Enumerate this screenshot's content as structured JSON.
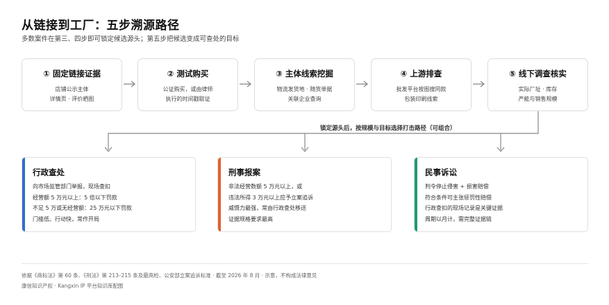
{
  "title": "从链接到工厂：五步溯源路径",
  "subtitle": "多数案件在第三、四步即可锁定候选源头；第五步把候选变成可查处的目标",
  "steps": [
    {
      "title": "① 固定链接证据",
      "lines": [
        "店铺公示主体",
        "详情页 · 评价晒图"
      ]
    },
    {
      "title": "② 测试购买",
      "lines": [
        "公证购买，或由律师",
        "执行的时间戳取证"
      ]
    },
    {
      "title": "③ 主体线索挖掘",
      "lines": [
        "物流发货地 · 随货单据",
        "关联企业查询"
      ]
    },
    {
      "title": "④ 上游排查",
      "lines": [
        "批发平台按图搜同款",
        "包装印刷线索"
      ]
    },
    {
      "title": "⑤ 线下调查核实",
      "lines": [
        "实际厂址 · 库存",
        "产能与销售规模"
      ]
    }
  ],
  "flow_label": "锁定源头后，按规模与目标选择打击路径（可组合）",
  "cards": [
    {
      "title": "行政查处",
      "color": "#2f6fd0",
      "lines": [
        "向市场监管部门举报，现场查扣",
        "经营额 5 万元以上：5 倍以下罚款",
        "不足 5 万或无经营额：25 万元以下罚款",
        "门槛低、行动快，常作开局"
      ]
    },
    {
      "title": "刑事报案",
      "color": "#e0622e",
      "lines": [
        "非法经营数额 5 万元以上，或",
        "违法所得 3 万元以上应予立案追诉",
        "威慑力最强，常由行政查处移送",
        "证据规格要求最高"
      ]
    },
    {
      "title": "民事诉讼",
      "color": "#1f9a73",
      "lines": [
        "判令停止侵害 + 损害赔偿",
        "符合条件可主张惩罚性赔偿",
        "行政查扣的现场记录是关键证据",
        "周期以月计，需完整证据链"
      ]
    }
  ],
  "footer": {
    "line1": "依据《商标法》第 60 条、《刑法》第 213–215 条及最高检、公安部立案追诉标准 · 截至 2026 年 8 月 · 示意，不构成法律意见",
    "line2": "康信知识产权 · Kangxin IP 平台知识库配图"
  }
}
